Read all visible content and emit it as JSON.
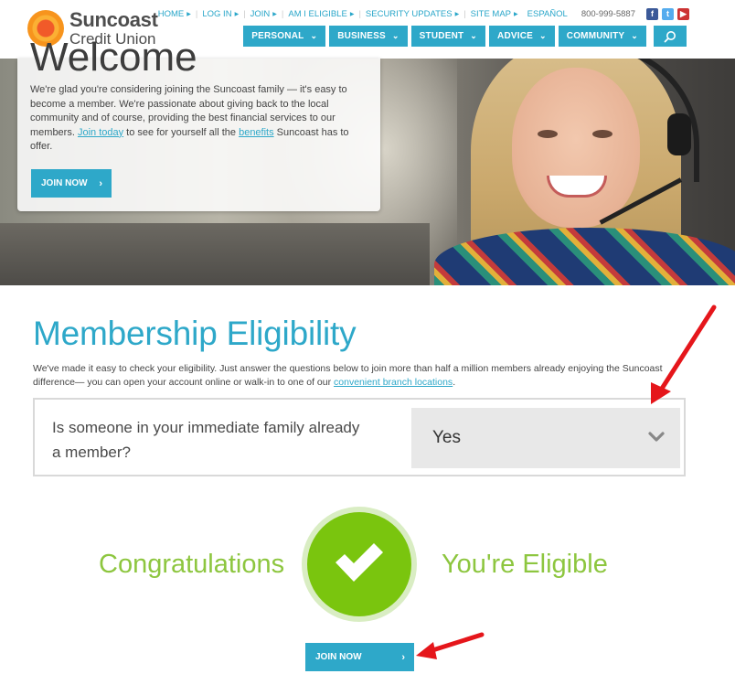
{
  "header": {
    "logo": {
      "name": "Suncoast",
      "sub": "Credit Union"
    },
    "utility_links": [
      "HOME",
      "LOG IN",
      "JOIN",
      "AM I ELIGIBLE",
      "SECURITY UPDATES",
      "SITE MAP"
    ],
    "espanol": "ESPAÑOL",
    "phone": "800-999-5887",
    "social": [
      {
        "icon": "facebook-icon",
        "glyph": "f"
      },
      {
        "icon": "twitter-icon",
        "glyph": "t"
      },
      {
        "icon": "youtube-icon",
        "glyph": "▶"
      }
    ],
    "nav": [
      {
        "label": "PERSONAL"
      },
      {
        "label": "BUSINESS"
      },
      {
        "label": "STUDENT"
      },
      {
        "label": "ADVICE"
      },
      {
        "label": "COMMUNITY"
      }
    ],
    "search_icon": "search-icon"
  },
  "hero": {
    "title": "Welcome",
    "text_before": "We're glad you're considering joining the Suncoast family — it's easy to become a member. We're passionate about giving back to the local community and of course, providing the best financial services to our members. ",
    "link_join_today": "Join today",
    "text_mid": " to see for yourself all the ",
    "link_benefits": "benefits",
    "text_after": " Suncoast has to offer.",
    "button": "JOIN NOW"
  },
  "eligibility": {
    "title": "Membership Eligibility",
    "intro_before": "We've made it easy to check your eligibility. Just answer the questions below to join more than half a million members already enjoying the Suncoast difference— you can open your account online or walk-in to one of our ",
    "intro_link": "convenient branch locations",
    "intro_after": ".",
    "question": "Is someone in your immediate family already a member?",
    "answer": "Yes",
    "congrats_left": "Congratulations",
    "congrats_right": "You're Eligible",
    "button": "JOIN NOW"
  },
  "colors": {
    "accent": "#2ea8c9",
    "success": "#7ac50e",
    "success_text": "#8dc63f",
    "annotation_arrow": "#e5161b"
  }
}
